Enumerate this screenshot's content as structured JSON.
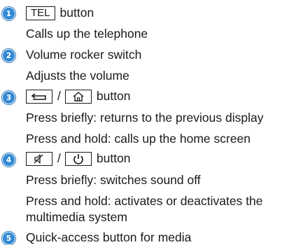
{
  "items": [
    {
      "number": "1",
      "key": "TEL",
      "title": "button",
      "lines": [
        "Calls up the telephone"
      ]
    },
    {
      "number": "2",
      "title": "Volume rocker switch",
      "lines": [
        "Adjusts the volume"
      ]
    },
    {
      "number": "3",
      "keys": [
        "back-icon",
        "home-icon"
      ],
      "separator": "/",
      "title": "button",
      "lines": [
        "Press briefly: returns to the previous display",
        "Press and hold: calls up the home screen"
      ]
    },
    {
      "number": "4",
      "keys": [
        "mute-icon",
        "power-icon"
      ],
      "separator": "/",
      "title": "button",
      "lines": [
        "Press briefly: switches sound off",
        "Press and hold: activates or deactivates the",
        "multimedia system"
      ]
    },
    {
      "number": "5",
      "title": "Quick-access button for media",
      "lines": []
    }
  ]
}
